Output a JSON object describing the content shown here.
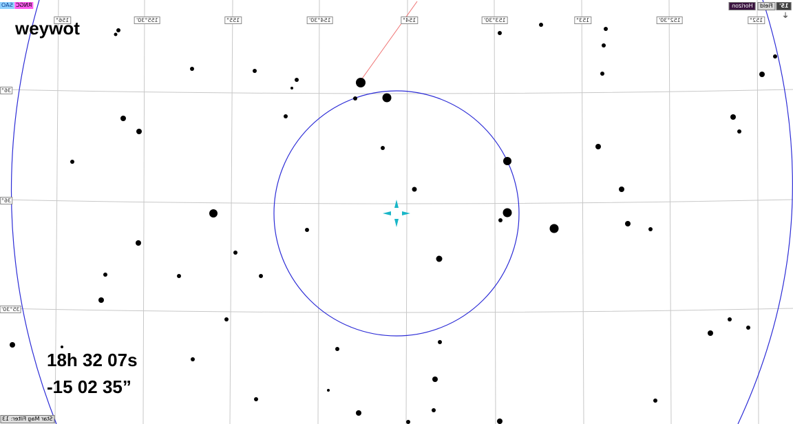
{
  "object_name": "weywot",
  "coordinates": {
    "ra": "18h 32 07s",
    "dec": "-15 02 35”"
  },
  "catalog_tags": {
    "sao": "SAO",
    "ngc": "RNGC"
  },
  "top_right": {
    "horizon": "Horizon",
    "field": "Field",
    "zoom": "15'"
  },
  "ra_grid_labels": [
    "156°",
    "155°30'",
    "155°",
    "154°30'",
    "154°",
    "153°30'",
    "153°",
    "152°30'",
    "152°"
  ],
  "dec_grid_labels": [
    "36°",
    "36°",
    "35°30'"
  ],
  "status": {
    "mag_filter": "Star Mag Filter: 13"
  },
  "icons": {
    "crosshair": "reticle-icon",
    "compass": "compass-icon"
  },
  "colors": {
    "grid": "#c7c7c7",
    "field_circle": "#2b2bd6",
    "reticle": "#19b6c7",
    "track_line": "#ef6f6f",
    "star": "#000000",
    "sao_tag": "#8fd1ff",
    "ngc_tag": "#ff5cf0",
    "horizon_button": "#3b1340"
  }
}
